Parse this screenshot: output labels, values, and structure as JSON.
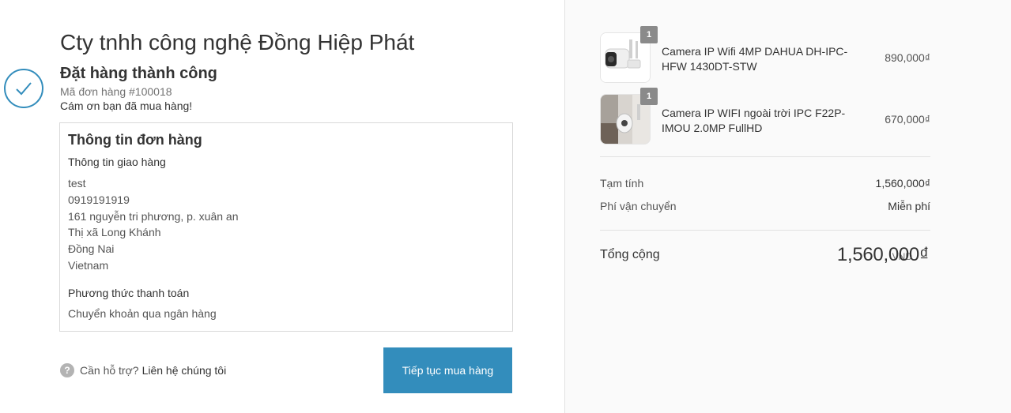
{
  "shop": {
    "name": "Cty tnhh công nghệ Đồng Hiệp Phát"
  },
  "status": {
    "title": "Đặt hàng thành công",
    "order_number": "Mã đơn hàng #100018",
    "thanks": "Cám ơn bạn đã mua hàng!"
  },
  "order_info": {
    "heading": "Thông tin đơn hàng",
    "shipping_heading": "Thông tin giao hàng",
    "address_lines": [
      "test",
      "0919191919",
      "161 nguyễn tri phương, p. xuân an",
      "Thị xã Long Khánh",
      "Đồng Nai",
      "Vietnam"
    ],
    "payment_heading": "Phương thức thanh toán",
    "payment_method": "Chuyển khoản qua ngân hàng"
  },
  "help": {
    "question": "Cần hỗ trợ?",
    "link": "Liên hệ chúng tôi",
    "icon": "?"
  },
  "actions": {
    "continue_label": "Tiếp tục mua hàng"
  },
  "cart": {
    "items": [
      {
        "name": "Camera IP Wifi 4MP DAHUA DH-IPC-HFW 1430DT-STW",
        "price": "890,000₫",
        "qty": "1",
        "icon": "camera-thumbnail"
      },
      {
        "name": "Camera IP WIFI ngoài trời IPC F22P-IMOU 2.0MP FullHD",
        "price": "670,000₫",
        "qty": "1",
        "icon": "camera-thumbnail"
      }
    ],
    "subtotal_label": "Tạm tính",
    "subtotal_value": "1,560,000₫",
    "shipping_label": "Phí vận chuyển",
    "shipping_value": "Miễn phí",
    "total_label": "Tổng cộng",
    "currency": "VND",
    "total_value": "1,560,000₫"
  },
  "colors": {
    "accent": "#338dbc",
    "sidebar_bg": "#fafafa",
    "badge": "#8a8a8a"
  }
}
